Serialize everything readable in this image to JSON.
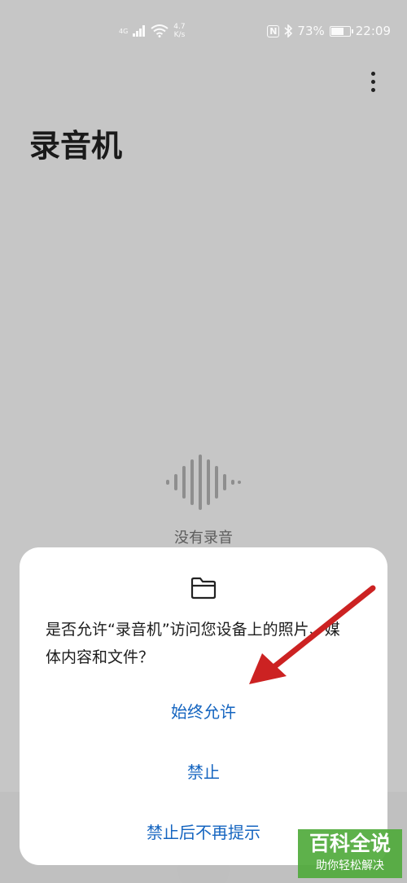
{
  "status_bar": {
    "network": "4G",
    "speed_value": "4.7",
    "speed_unit": "K/s",
    "nfc": "N",
    "battery": "73%",
    "battery_level": 0.73,
    "time": "22:09"
  },
  "app": {
    "title": "录音机",
    "empty_text": "没有录音"
  },
  "dialog": {
    "message": "是否允许“录音机”访问您设备上的照片、媒体内容和文件？",
    "always_allow": "始终允许",
    "deny": "禁止",
    "deny_forever": "禁止后不再提示"
  },
  "watermark": {
    "line1": "百科全说",
    "line2": "助你轻松解决"
  },
  "colors": {
    "accent": "#1565c0",
    "arrow": "#cc2222",
    "background": "#c6c6c6"
  }
}
